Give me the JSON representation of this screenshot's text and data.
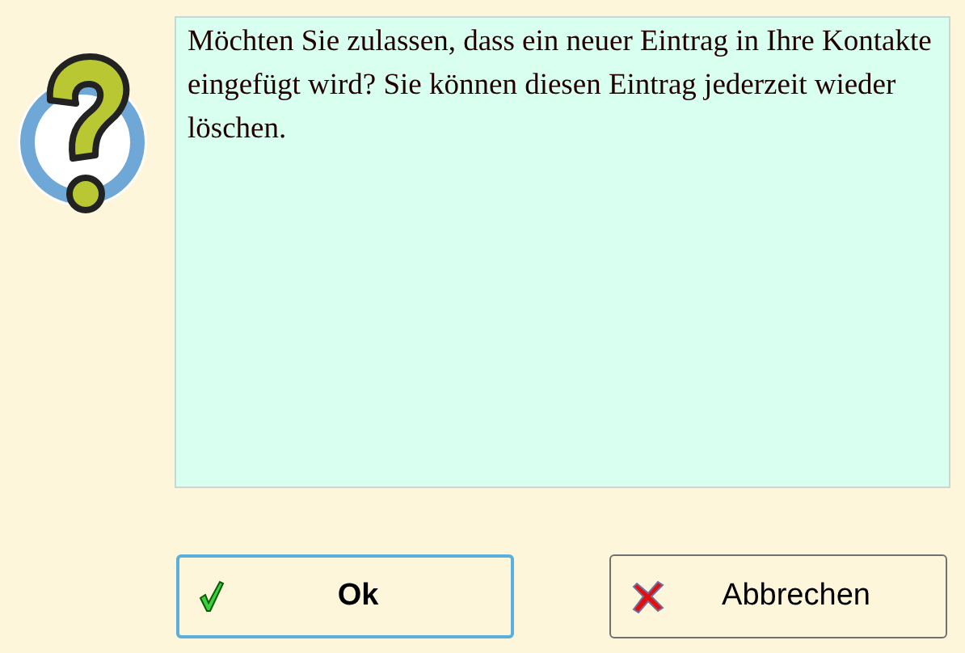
{
  "message": "Möchten Sie zulassen, dass ein neuer Eintrag in Ihre Kontakte eingefügt wird? Sie können diesen Eintrag jederzeit wieder löschen.",
  "buttons": [
    {
      "label": "Ok",
      "kind": "ok",
      "focused": true
    },
    {
      "label": "Abbrechen",
      "kind": "cancel",
      "focused": false
    }
  ]
}
